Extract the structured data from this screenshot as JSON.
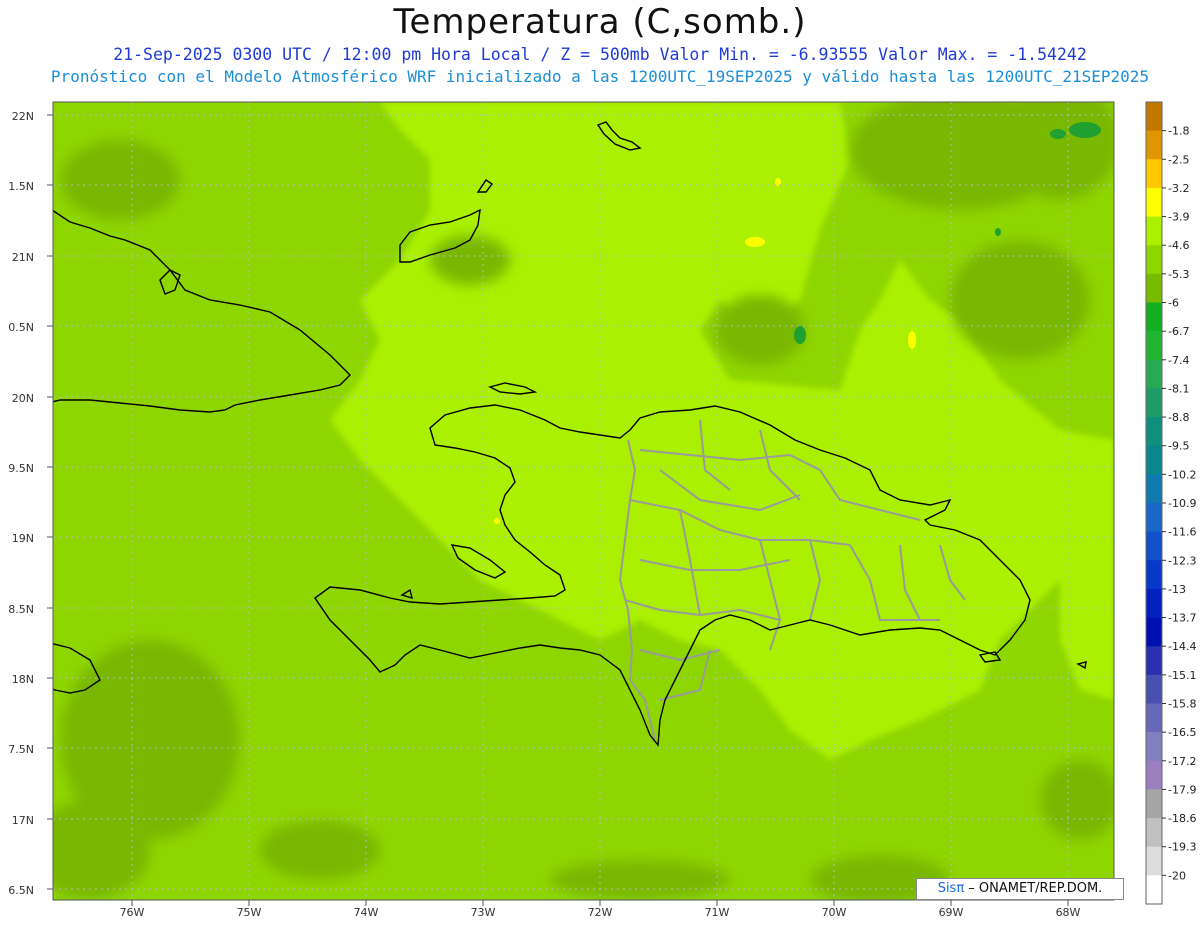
{
  "header": {
    "title": "Temperatura (C,somb.)",
    "line1": "21-Sep-2025  0300 UTC / 12:00 pm Hora Local / Z = 500mb  Valor Min. = -6.93555  Valor Max. = -1.54242",
    "line2": "Pronóstico con el Modelo Atmosférico WRF inicializado a las 1200UTC_19SEP2025 y válido hasta las  1200UTC_21SEP2025"
  },
  "map": {
    "lat_labels": [
      "22N",
      "1.5N",
      "21N",
      "0.5N",
      "20N",
      "9.5N",
      "19N",
      "8.5N",
      "18N",
      "7.5N",
      "17N",
      "6.5N"
    ],
    "lon_labels": [
      "76W",
      "75W",
      "74W",
      "73W",
      "72W",
      "71W",
      "70W",
      "69W",
      "68W"
    ],
    "colors": {
      "base": "#8ed600",
      "light": "#aaf000",
      "dark": "#79b800",
      "coast": "#000000",
      "borders": "#9a9a9a",
      "grid": "#bbbbbb"
    }
  },
  "legend": {
    "labels": [
      "-1.8",
      "-2.5",
      "-3.2",
      "-3.9",
      "-4.6",
      "-5.3",
      "-6",
      "-6.7",
      "-7.4",
      "-8.1",
      "-8.8",
      "-9.5",
      "-10.2",
      "-10.9",
      "-11.6",
      "-12.3",
      "-13",
      "-13.7",
      "-14.4",
      "-15.1",
      "-15.8",
      "-16.5",
      "-17.2",
      "-17.9",
      "-18.6",
      "-19.3",
      "-20"
    ],
    "colors": [
      "#c07800",
      "#e09600",
      "#ffc800",
      "#ffff00",
      "#aaf000",
      "#8ed600",
      "#78bc00",
      "#10b020",
      "#20b430",
      "#28a850",
      "#209a68",
      "#10907c",
      "#08888c",
      "#107ab0",
      "#1868c8",
      "#1050c8",
      "#0838c8",
      "#0020c0",
      "#0010b0",
      "#2830b0",
      "#4850b0",
      "#6868b8",
      "#8080c0",
      "#9b80c0",
      "#a6a6a6",
      "#c0c0c0",
      "#dcdcdc",
      "#ffffff"
    ]
  },
  "credit": {
    "brand": "Sisπ",
    "text": " – ONAMET/REP.DOM."
  }
}
